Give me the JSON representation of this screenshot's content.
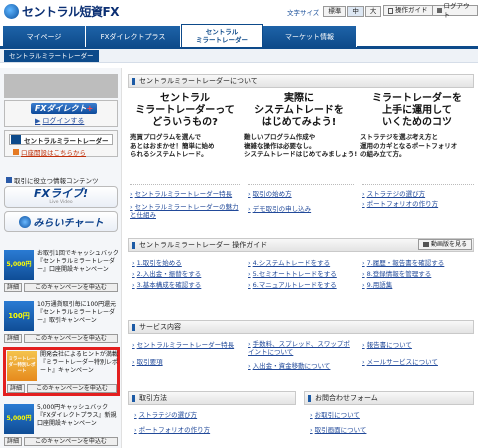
{
  "header": {
    "logo": "セントラル短資FX",
    "font_size_label": "文字サイズ",
    "font_sizes": [
      "標準",
      "中",
      "大"
    ],
    "operation_guide": "操作ガイド",
    "logout": "ログアウト"
  },
  "tabs": [
    "マイページ",
    "FXダイレクトプラス",
    "セントラル\nミラートレーダー",
    "マーケット情報"
  ],
  "subnav": "セントラルミラートレーダー",
  "sidebar": {
    "fxdirect_logo": "FXダイレクト",
    "fxdirect_plus": "+",
    "login_label": "ログインする",
    "mirror_title": "セントラルミラートレーダー",
    "mirror_link": "口座開設はこちらから",
    "info_contents": "取引に役立つ情報コンテンツ",
    "fxlive": "FXライブ!",
    "fxlive_sub": "Live Video",
    "miraichart": "みらいチャート",
    "promos": [
      {
        "text": "お取引1回でキャッシュバック『セントラルミラートレーダー』口座開設キャンペーン",
        "badge": "5,000円",
        "detail": "詳細",
        "apply": "このキャンペーンを申込む"
      },
      {
        "text": "10万通貨取引毎に100円還元『セントラルミラートレーダー』取引キャンペーン",
        "badge": "100円",
        "detail": "詳細",
        "apply": "このキャンペーンを申込む"
      },
      {
        "text": "開発会社によるヒントが満載『ミラートレーダー特別レポート』キャンペーン",
        "badge": "ミラートレーダー特別レポート",
        "detail": "詳細",
        "apply": "このキャンペーンを申込む"
      },
      {
        "text": "5,000円キャッシュバック『FXダイレクトプラス』新規口座開設キャンペーン",
        "badge": "5,000円",
        "detail": "詳細",
        "apply": "このキャンペーンを申込む"
      }
    ]
  },
  "about": {
    "title": "セントラルミラートレーダーについて",
    "features": [
      {
        "title": "セントラル\nミラートレーダーって\nどういうもの?",
        "body": "売買プログラムを選んで\nあとはおまかせ！簡単に始め\nられるシステムトレード。"
      },
      {
        "title": "実際に\nシステムトレードを\nはじめてみよう!",
        "body": "難しいプログラム作成や\n複雑な操作は必要なし。\nシステムトレードはじめてみましょう!"
      },
      {
        "title": "ミラートレーダーを\n上手に運用して\nいくためのコツ",
        "body": "ストラテジを選ぶ考え方と\n運用のカギとなるポートフォリオ\nの組み立て方。"
      }
    ],
    "links": [
      [
        "セントラルミラートレーダー特長",
        "セントラルミラートレーダーの魅力と仕組み"
      ],
      [
        "取引の始め方",
        "デモ取引の申し込み"
      ],
      [
        "ストラテジの選び方",
        "ポートフォリオの作り方"
      ]
    ]
  },
  "guide": {
    "title": "セントラルミラートレーダー 操作ガイド",
    "video_btn": "動画版を見る",
    "items": [
      [
        "1.取引を始める",
        "2.入出金・振替をする",
        "3.基本構成を確認する"
      ],
      [
        "4.システムトレードをする",
        "5.セミオートトレードをする",
        "6.マニュアルトレードをする"
      ],
      [
        "7.履歴・報告書を確認する",
        "8.登録情報を管理する",
        "9.用語集"
      ]
    ]
  },
  "service": {
    "title": "サービス内容",
    "items": [
      [
        "セントラルミラートレーダー特長",
        "取引要項"
      ],
      [
        "手数料、スプレッド、スワップポイントについて",
        "入出金・資金移動について"
      ],
      [
        "報告書について",
        "メールサービスについて"
      ]
    ]
  },
  "trading": {
    "title": "取引方法",
    "items": [
      "ストラテジの選び方",
      "ポートフォリオの作り方"
    ]
  },
  "contact": {
    "title": "お問合わせフォーム",
    "items": [
      "お取引について",
      "取引画面について"
    ]
  }
}
